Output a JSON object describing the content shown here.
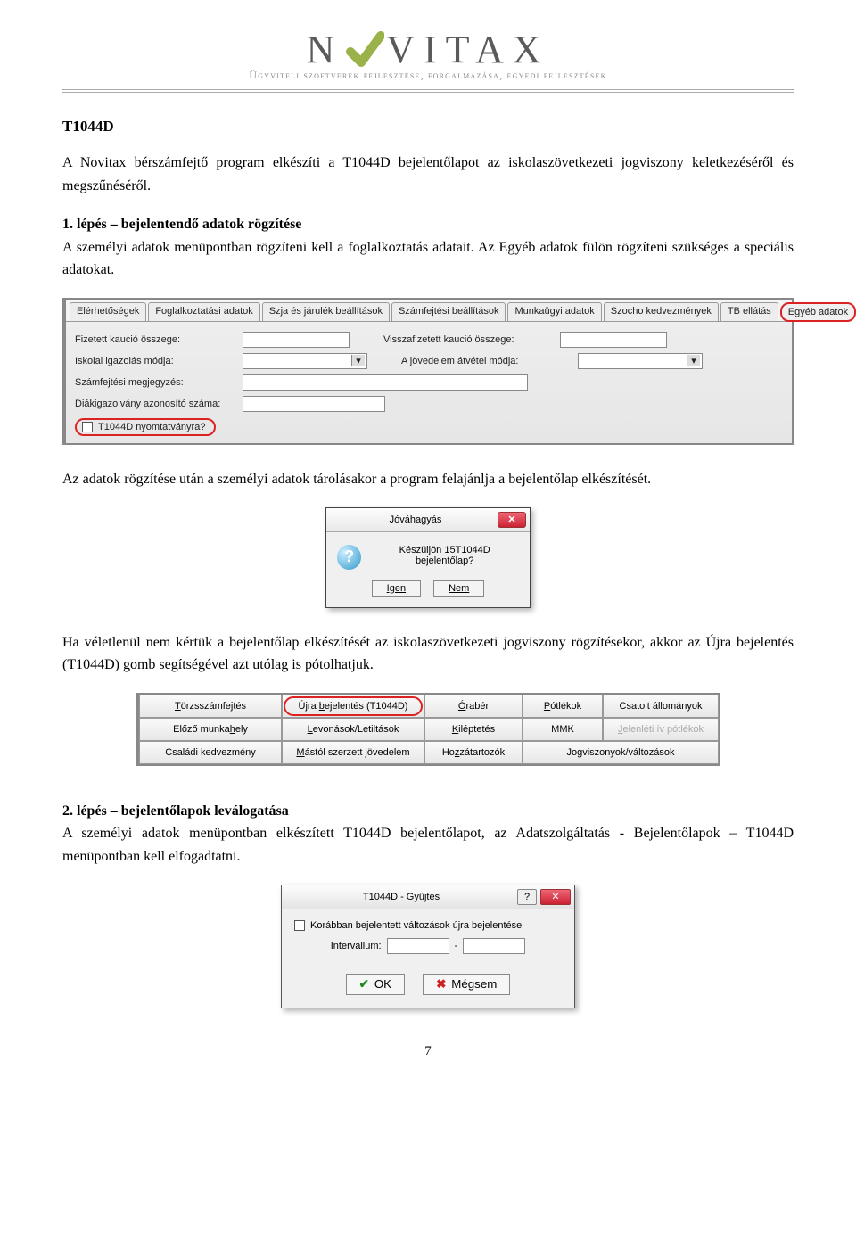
{
  "logo": {
    "brand_left": "N",
    "brand_mid": "VITAX",
    "tagline": "Ügyviteli szoftverek fejlesztése, forgalmazása, egyedi fejlesztések"
  },
  "heading": "T1044D",
  "para1": "A Novitax bérszámfejtő program elkészíti a T1044D bejelentőlapot az iskolaszövetkezeti jogviszony keletkezéséről és megszűnéséről.",
  "step1": {
    "title": "1. lépés – bejelentendő adatok rögzítése",
    "text": "A személyi adatok menüpontban rögzíteni kell a foglalkoztatás adatait. Az Egyéb adatok fülön rögzíteni szükséges a speciális adatokat."
  },
  "screenshot1": {
    "tabs": [
      "Elérhetőségek",
      "Foglalkoztatási adatok",
      "Szja és járulék beállítások",
      "Számfejtési beállítások",
      "Munkaügyi adatok",
      "Szocho kedvezmények",
      "TB ellátás",
      "Egyéb adatok"
    ],
    "row1a": "Fizetett kaució összege:",
    "row1b": "Visszafizetett kaució összege:",
    "row2a": "Iskolai igazolás módja:",
    "row2b": "A jövedelem átvétel módja:",
    "row3": "Számfejtési megjegyzés:",
    "row4": "Diákigazolvány azonosító száma:",
    "checkbox": "T1044D nyomtatványra?"
  },
  "para2": "Az adatok rögzítése után a személyi adatok tárolásakor a program felajánlja a bejelentőlap elkészítését.",
  "dialog1": {
    "title": "Jóváhagyás",
    "message": "Készüljön 15T1044D bejelentőlap?",
    "yes": "Igen",
    "no": "Nem"
  },
  "para3": "Ha véletlenül nem kértük a bejelentőlap elkészítését az iskolaszövetkezeti jogviszony rögzítésekor, akkor az Újra bejelentés (T1044D) gomb segítségével azt utólag is pótolhatjuk.",
  "buttonGrid": {
    "r1": [
      "Törzsszámfejtés",
      "Újra bejelentés (T1044D)",
      "Órabér",
      "Pótlékok",
      "Csatolt állományok"
    ],
    "r2": [
      "Előző munkahely",
      "Levonások/Letiltások",
      "Kiléptetés",
      "MMK",
      "Jelenléti ív pótlékok"
    ],
    "r3": [
      "Családi kedvezmény",
      "Mástól szerzett jövedelem",
      "Hozzátartozók",
      "Jogviszonyok/változások",
      ""
    ]
  },
  "step2": {
    "title": "2. lépés – bejelentőlapok leválogatása",
    "text": "A személyi adatok menüpontban elkészített T1044D bejelentőlapot, az Adatszolgáltatás - Bejelentőlapok – T1044D menüpontban kell elfogadtatni."
  },
  "dialog2": {
    "title": "T1044D - Gyűjtés",
    "checkbox": "Korábban bejelentett változások újra bejelentése",
    "interval_label": "Intervallum:",
    "ok": "OK",
    "cancel": "Mégsem"
  },
  "pagenum": "7"
}
